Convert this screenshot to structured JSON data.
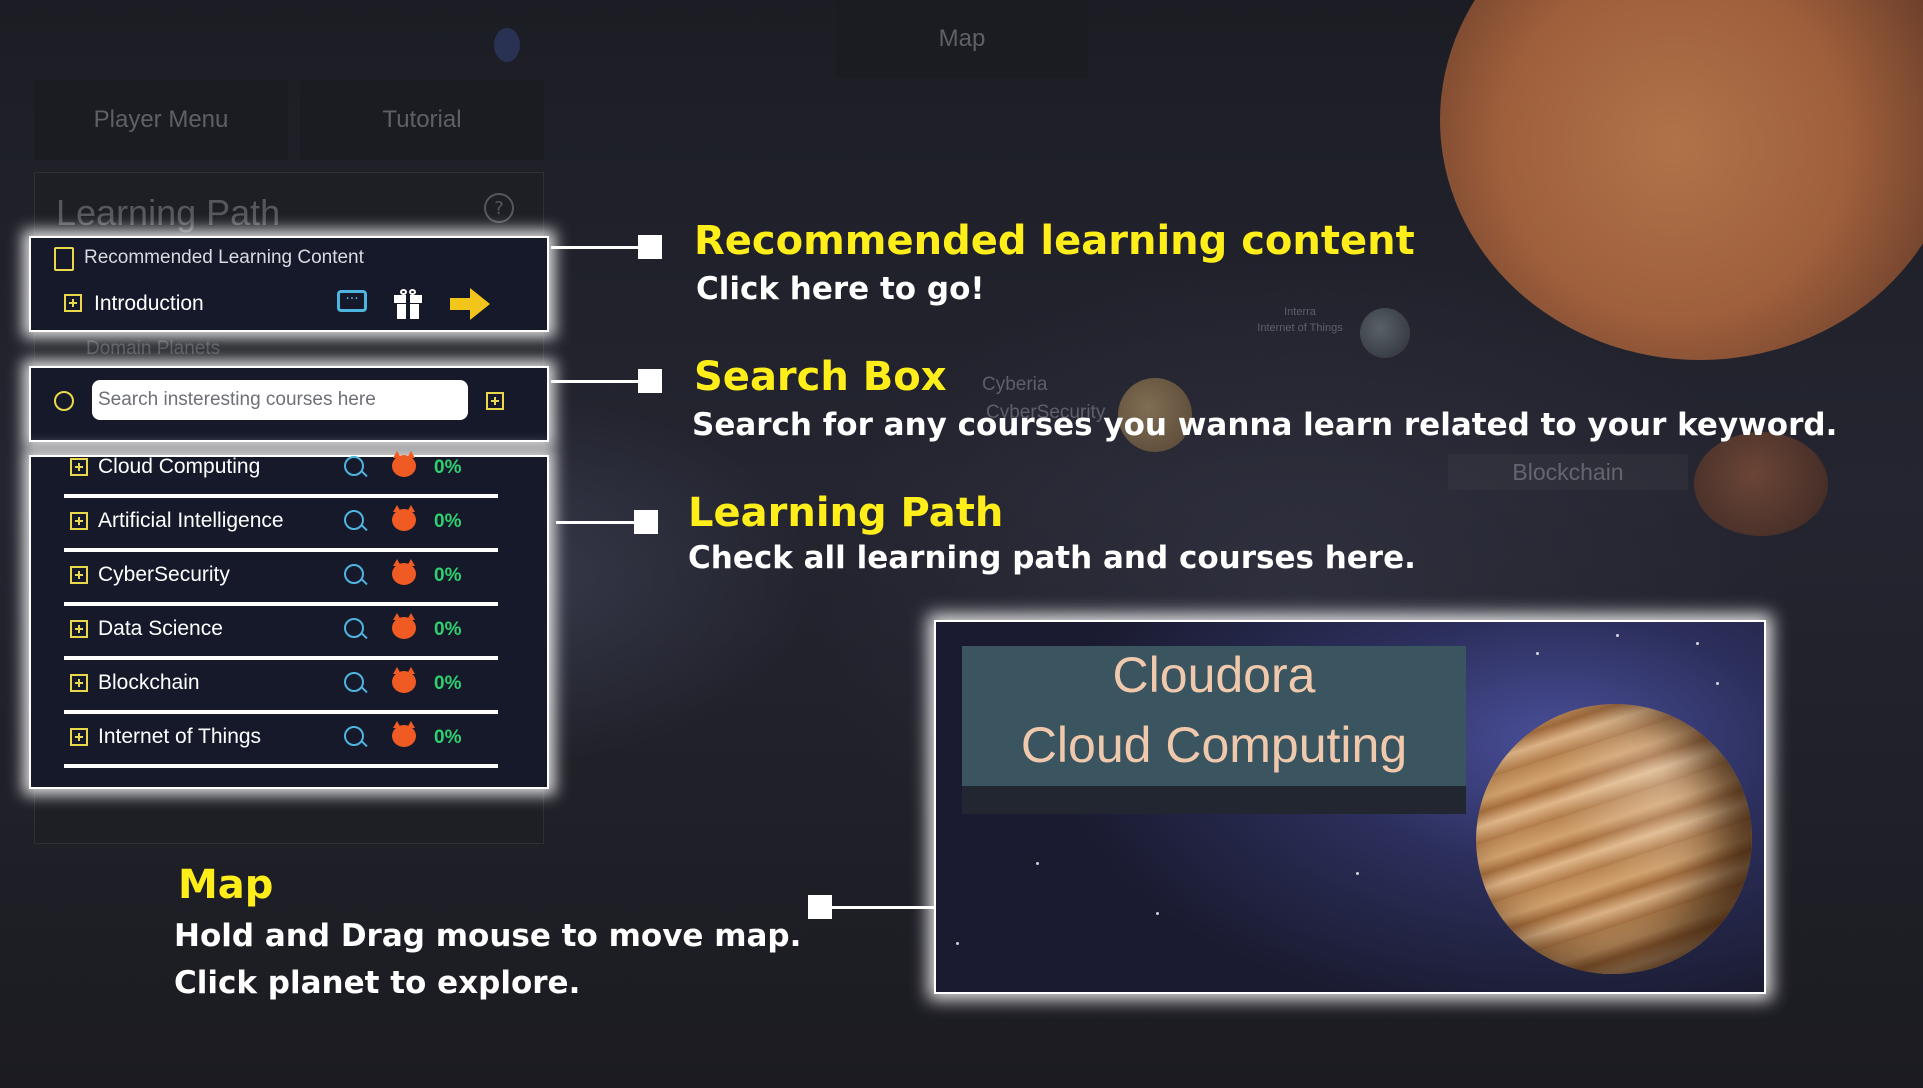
{
  "top_bar": {
    "map_tab": "Map"
  },
  "menu": {
    "player_menu": "Player Menu",
    "tutorial": "Tutorial"
  },
  "learning_path": {
    "title": "Learning Path",
    "help_icon": "?",
    "recommended_header": "Recommended Learning Content",
    "recommended_item": "Introduction",
    "domain_planets_label": "Domain Planets",
    "search_placeholder": "Search insteresting courses here",
    "courses": [
      {
        "name": "Cloud Computing",
        "progress": "0%"
      },
      {
        "name": "Artificial Intelligence",
        "progress": "0%"
      },
      {
        "name": "CyberSecurity",
        "progress": "0%"
      },
      {
        "name": "Data Science",
        "progress": "0%"
      },
      {
        "name": "Blockchain",
        "progress": "0%"
      },
      {
        "name": "Internet of Things",
        "progress": "0%"
      }
    ]
  },
  "background_labels": {
    "cyberia": "Cyberia",
    "cybersecurity": "CyberSecurity",
    "blockchain": "Blockchain",
    "iot_short": "Interra",
    "iot_long": "Internet of Things"
  },
  "annotations": {
    "recommended": {
      "title": "Recommended learning content",
      "desc": "Click here to go!"
    },
    "search": {
      "title": "Search Box",
      "desc": "Search for any courses you wanna learn related to your keyword."
    },
    "learning_path": {
      "title": "Learning Path",
      "desc": "Check all learning path and courses here."
    },
    "map": {
      "title": "Map",
      "desc_line1": "Hold and Drag mouse to move map.",
      "desc_line2": "Click planet to explore."
    }
  },
  "map_preview": {
    "planet_name": "Cloudora",
    "domain": "Cloud Computing"
  },
  "icons": {
    "recommended": "clipboard-check-icon",
    "chat": "chat-bubble-icon",
    "gift": "gift-icon",
    "go": "arrow-right-icon",
    "search": "search-icon",
    "add": "plus-icon",
    "difficulty": "devil-icon"
  },
  "colors": {
    "annotation_title": "#ffee1a",
    "progress": "#2ed070",
    "plus_icon": "#e8d84a",
    "panel_bg": "#15192a",
    "map_label_bg": "#3a5560",
    "map_label_text": "#f0c9ad"
  }
}
